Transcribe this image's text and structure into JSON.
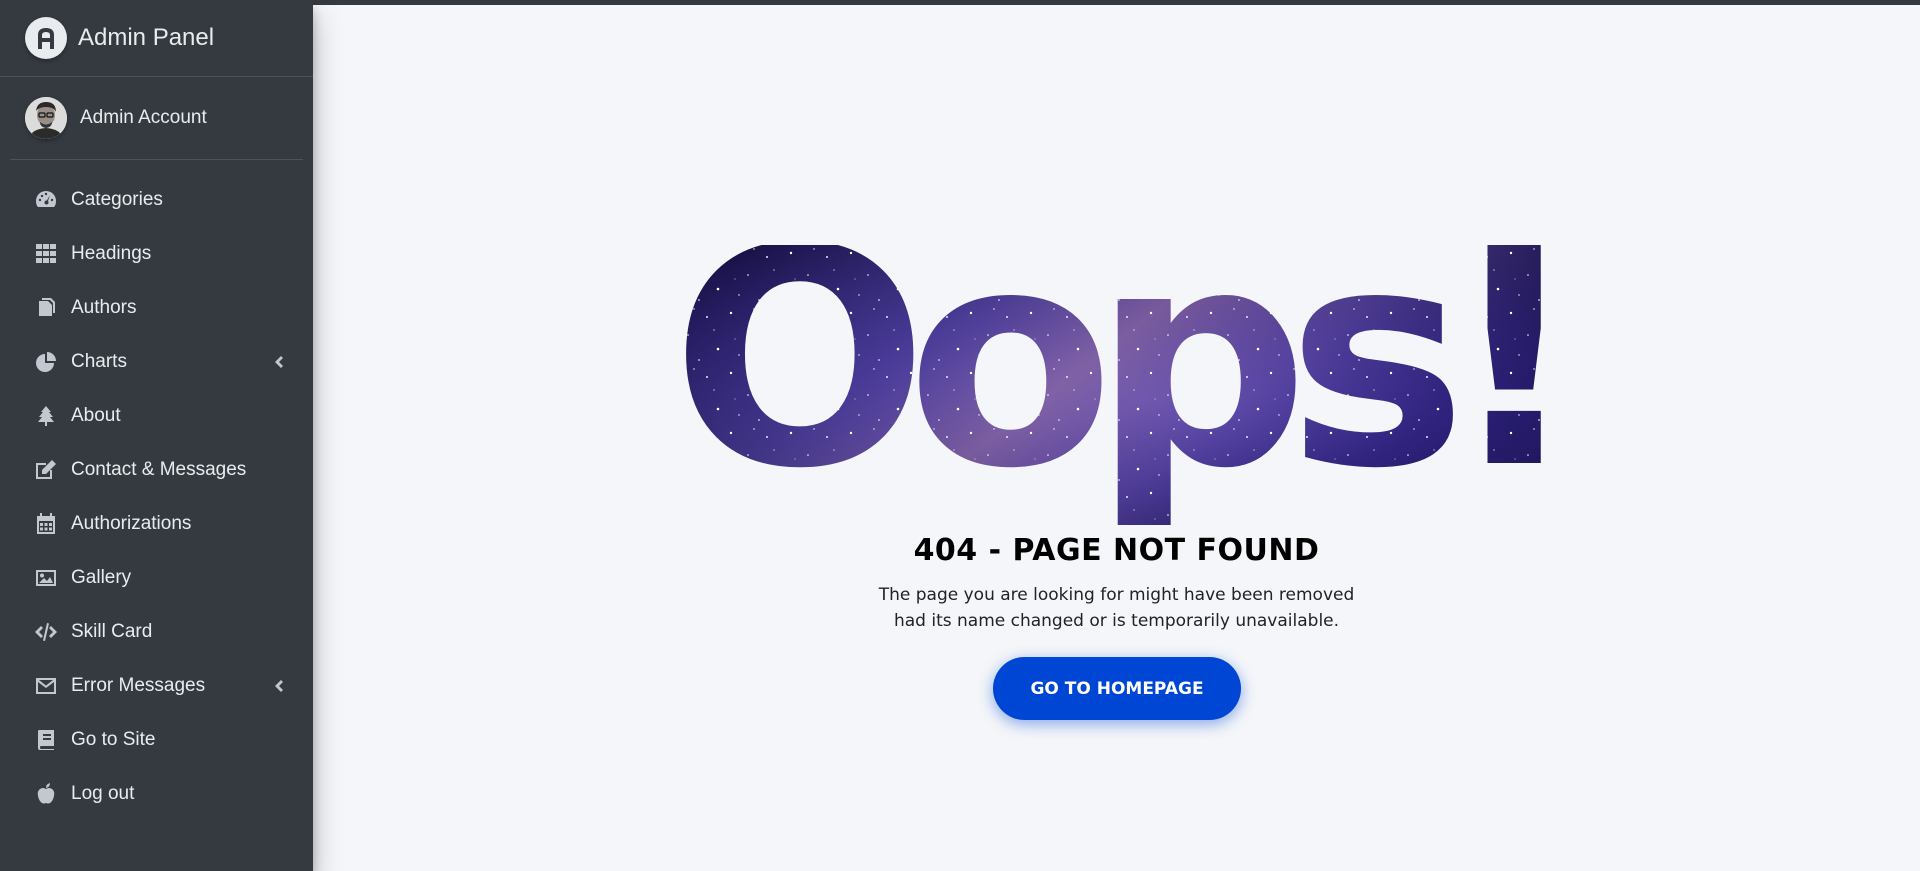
{
  "brand": {
    "title": "Admin Panel",
    "logo_icon": "a-letter-logo-icon"
  },
  "user": {
    "name": "Admin Account"
  },
  "sidebar": {
    "items": [
      {
        "label": "Categories",
        "icon": "tachometer-icon",
        "has_arrow": false
      },
      {
        "label": "Headings",
        "icon": "grid-icon",
        "has_arrow": false
      },
      {
        "label": "Authors",
        "icon": "copy-icon",
        "has_arrow": false
      },
      {
        "label": "Charts",
        "icon": "pie-chart-icon",
        "has_arrow": true
      },
      {
        "label": "About",
        "icon": "tree-icon",
        "has_arrow": false
      },
      {
        "label": "Contact & Messages",
        "icon": "edit-icon",
        "has_arrow": false
      },
      {
        "label": "Authorizations",
        "icon": "calendar-icon",
        "has_arrow": false
      },
      {
        "label": "Gallery",
        "icon": "image-icon",
        "has_arrow": false
      },
      {
        "label": "Skill Card",
        "icon": "code-icon",
        "has_arrow": false
      },
      {
        "label": "Error Messages",
        "icon": "envelope-icon",
        "has_arrow": true
      },
      {
        "label": "Go to Site",
        "icon": "book-icon",
        "has_arrow": false
      },
      {
        "label": "Log out",
        "icon": "apple-icon",
        "has_arrow": false
      }
    ]
  },
  "error_page": {
    "headline": "Oops!",
    "title": "404 - PAGE NOT FOUND",
    "description_line1": "The page you are looking for might have been removed",
    "description_line2": "had its name changed or is temporarily unavailable.",
    "button_label": "GO TO HOMEPAGE"
  },
  "colors": {
    "sidebar_bg": "#343a40",
    "content_bg": "#f4f6f9",
    "button_bg": "#0046d5",
    "galaxy_dark": "#1a1050",
    "galaxy_mid": "#3a2a8a"
  }
}
